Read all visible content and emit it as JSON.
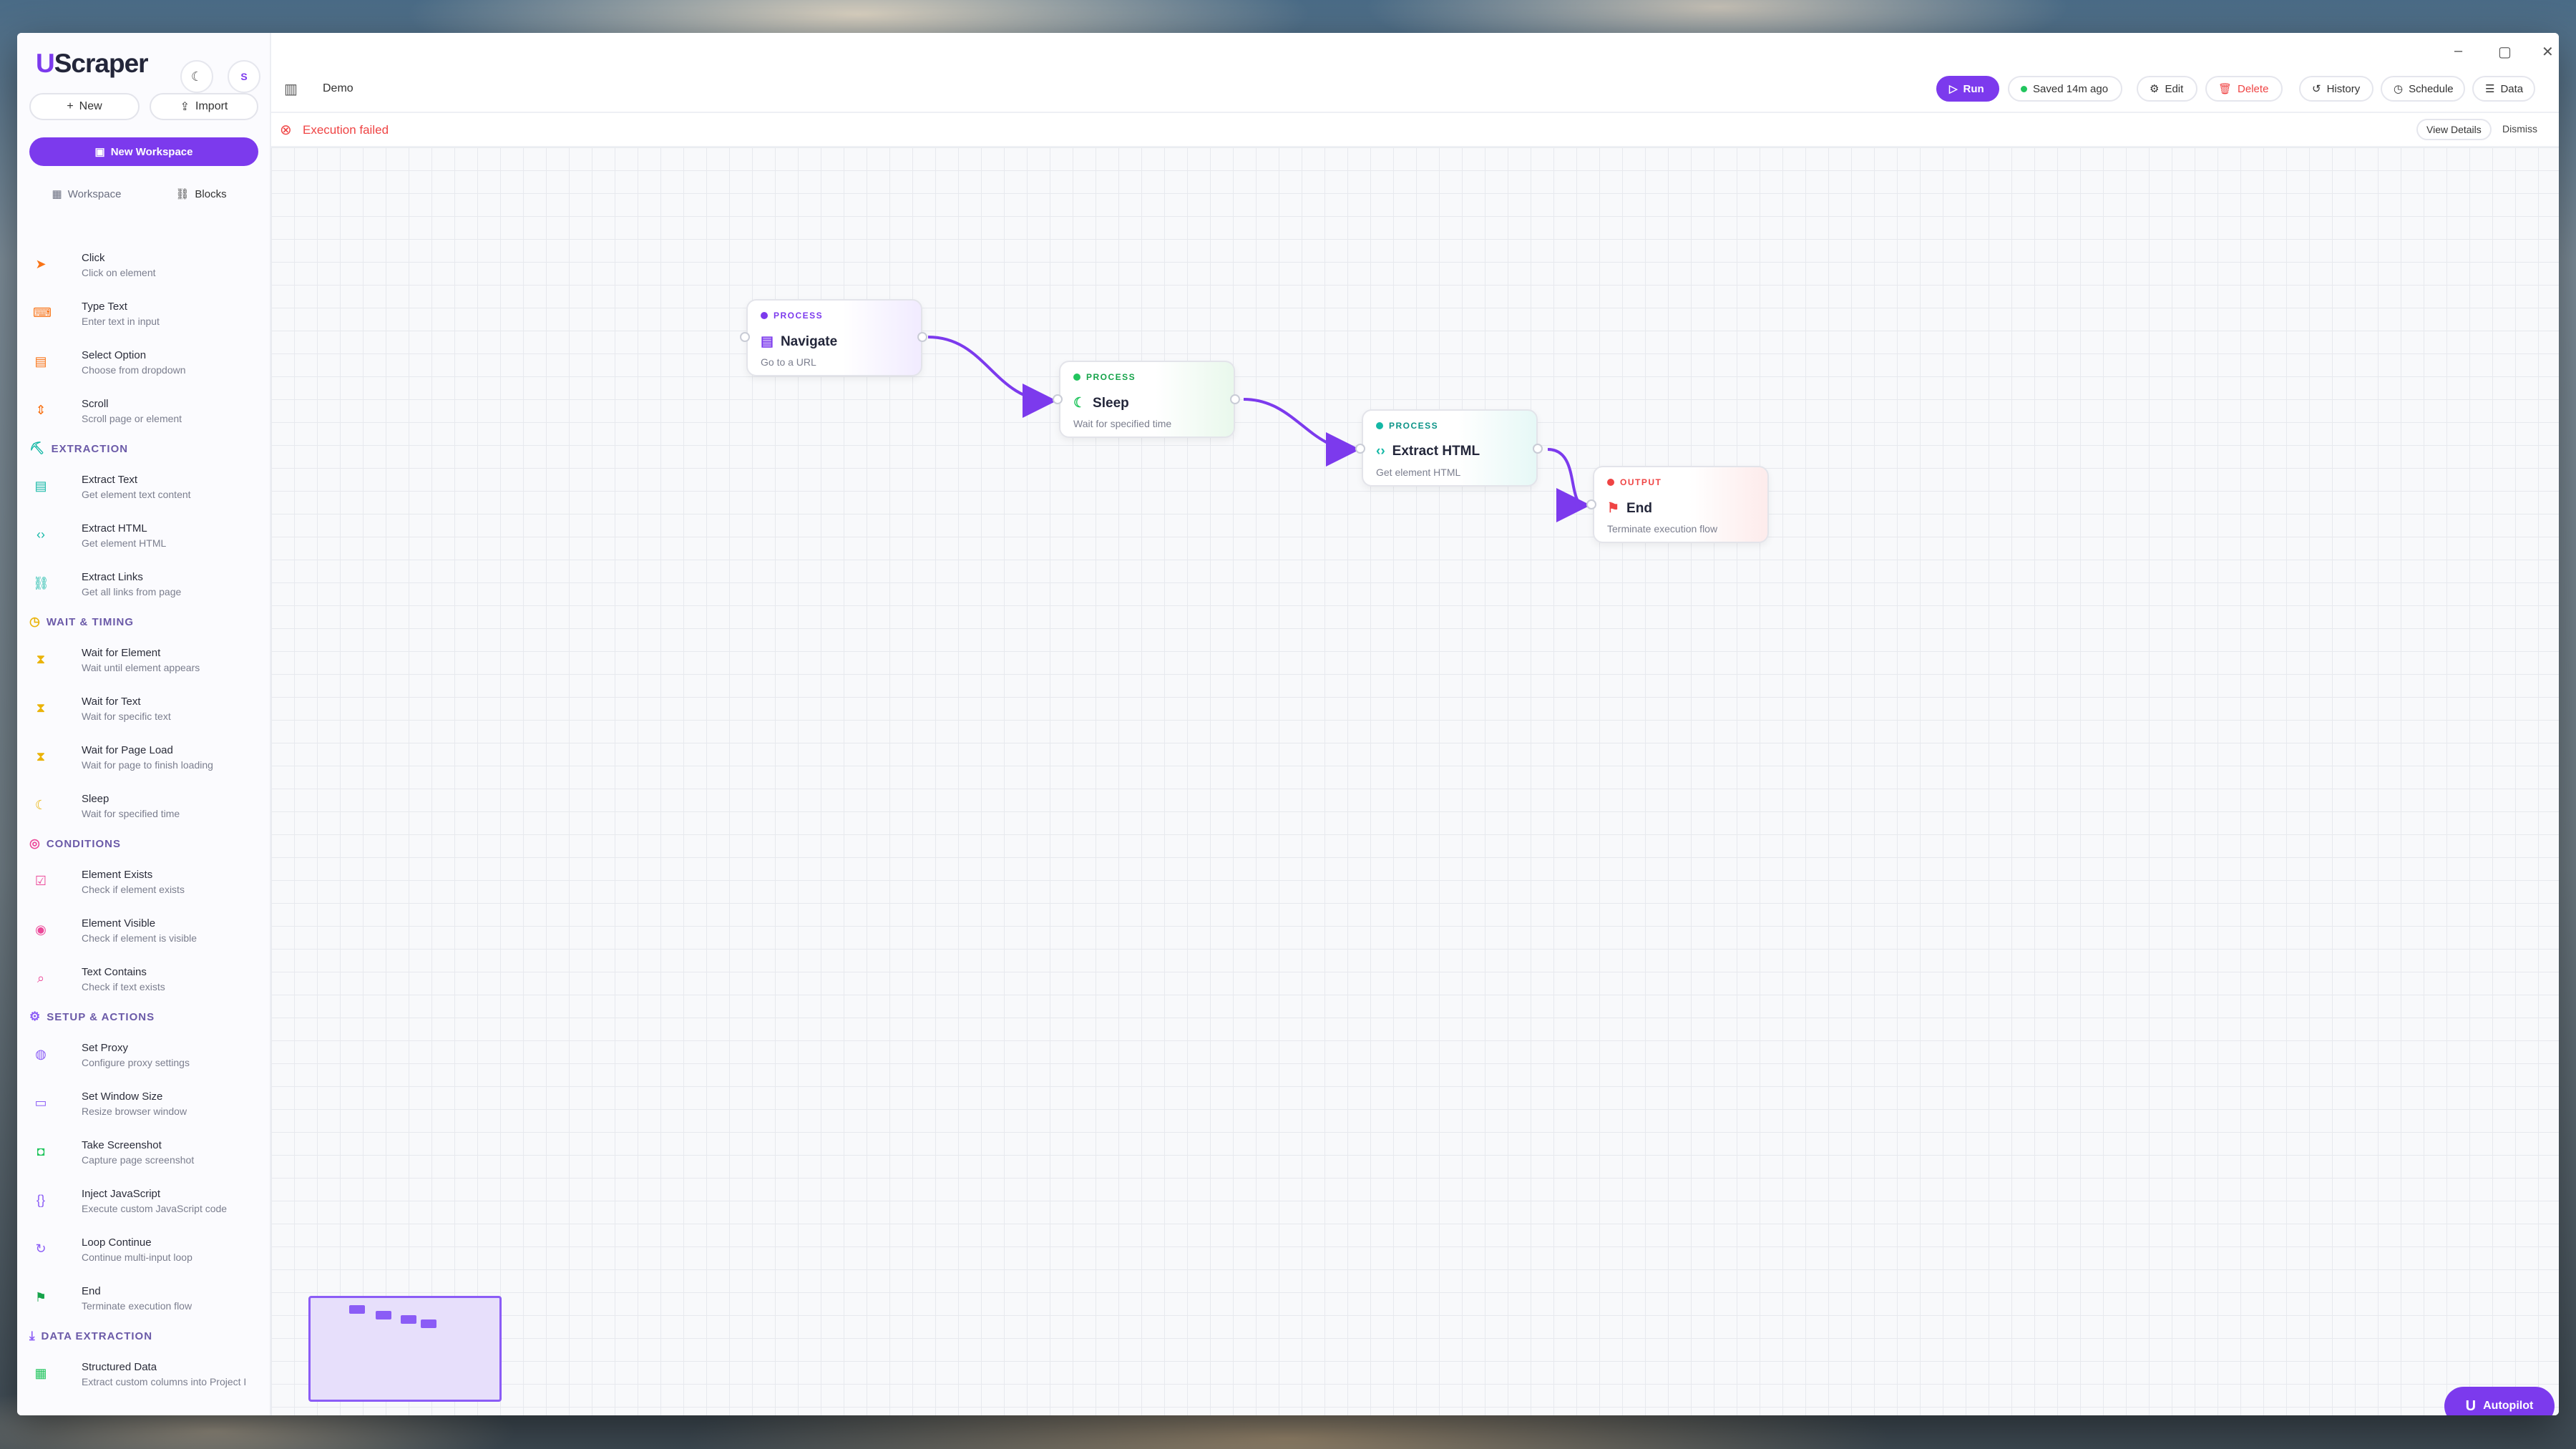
{
  "app": {
    "logo_prefix": "U",
    "logo_rest": "Scraper",
    "avatar": "S"
  },
  "sidebar": {
    "new_label": "New",
    "import_label": "Import",
    "new_workspace_label": "New Workspace",
    "tabs": [
      {
        "label": "Workspace"
      },
      {
        "label": "Blocks"
      }
    ],
    "sections": {
      "extraction": "EXTRACTION",
      "wait": "WAIT & TIMING",
      "conditions": "CONDITIONS",
      "setup": "SETUP & ACTIONS",
      "data_extraction": "DATA EXTRACTION"
    },
    "blocks": [
      {
        "title": "Click",
        "desc": "Click on element",
        "icon": "pointer-icon",
        "color": "#f97316"
      },
      {
        "title": "Type Text",
        "desc": "Enter text in input",
        "icon": "keyboard-icon",
        "color": "#f97316"
      },
      {
        "title": "Select Option",
        "desc": "Choose from dropdown",
        "icon": "list-icon",
        "color": "#f97316"
      },
      {
        "title": "Scroll",
        "desc": "Scroll page or element",
        "icon": "scroll-icon",
        "color": "#f97316"
      },
      {
        "title": "Extract Text",
        "desc": "Get element text content",
        "icon": "text-file-icon",
        "color": "#14b8a6"
      },
      {
        "title": "Extract HTML",
        "desc": "Get element HTML",
        "icon": "code-icon",
        "color": "#14b8a6"
      },
      {
        "title": "Extract Links",
        "desc": "Get all links from page",
        "icon": "link-icon",
        "color": "#14b8a6"
      },
      {
        "title": "Wait for Element",
        "desc": "Wait until element appears",
        "icon": "hourglass-icon",
        "color": "#eab308"
      },
      {
        "title": "Wait for Text",
        "desc": "Wait for specific text",
        "icon": "hourglass-icon",
        "color": "#eab308"
      },
      {
        "title": "Wait for Page Load",
        "desc": "Wait for page to finish loading",
        "icon": "hourglass-icon",
        "color": "#eab308"
      },
      {
        "title": "Sleep",
        "desc": "Wait for specified time",
        "icon": "moon-icon",
        "color": "#eab308"
      },
      {
        "title": "Element Exists",
        "desc": "Check if element exists",
        "icon": "check-square-icon",
        "color": "#ec4899"
      },
      {
        "title": "Element Visible",
        "desc": "Check if element is visible",
        "icon": "eye-icon",
        "color": "#ec4899"
      },
      {
        "title": "Text Contains",
        "desc": "Check if text exists",
        "icon": "text-search-icon",
        "color": "#ec4899"
      },
      {
        "title": "Set Proxy",
        "desc": "Configure proxy settings",
        "icon": "globe-icon",
        "color": "#8b5cf6"
      },
      {
        "title": "Set Window Size",
        "desc": "Resize browser window",
        "icon": "window-icon",
        "color": "#8b5cf6"
      },
      {
        "title": "Take Screenshot",
        "desc": "Capture page screenshot",
        "icon": "camera-icon",
        "color": "#22c55e"
      },
      {
        "title": "Inject JavaScript",
        "desc": "Execute custom JavaScript code",
        "icon": "braces-icon",
        "color": "#8b5cf6"
      },
      {
        "title": "Loop Continue",
        "desc": "Continue multi-input loop",
        "icon": "loop-icon",
        "color": "#8b5cf6"
      },
      {
        "title": "End",
        "desc": "Terminate execution flow",
        "icon": "flag-icon",
        "color": "#16a34a"
      },
      {
        "title": "Structured Data",
        "desc": "Extract custom columns into Project I",
        "icon": "table-icon",
        "color": "#22c55e"
      }
    ]
  },
  "toolbar": {
    "workspace_name": "Demo",
    "run_label": "Run",
    "saved_label": "Saved 14m ago",
    "edit_label": "Edit",
    "delete_label": "Delete",
    "history_label": "History",
    "schedule_label": "Schedule",
    "data_label": "Data"
  },
  "error": {
    "message": "Execution failed",
    "view_details": "View Details",
    "dismiss": "Dismiss"
  },
  "nodes": [
    {
      "category": "PROCESS",
      "name": "Navigate",
      "desc": "Go to a URL",
      "icon": "browser-icon",
      "color": "#7c3aed"
    },
    {
      "category": "PROCESS",
      "name": "Sleep",
      "desc": "Wait for specified time",
      "icon": "moon-icon",
      "color": "#22c55e"
    },
    {
      "category": "PROCESS",
      "name": "Extract HTML",
      "desc": "Get element HTML",
      "icon": "code-icon",
      "color": "#14b8a6"
    },
    {
      "category": "OUTPUT",
      "name": "End",
      "desc": "Terminate execution flow",
      "icon": "flag-icon",
      "color": "#ef4444"
    }
  ],
  "autopilot_label": "Autopilot"
}
